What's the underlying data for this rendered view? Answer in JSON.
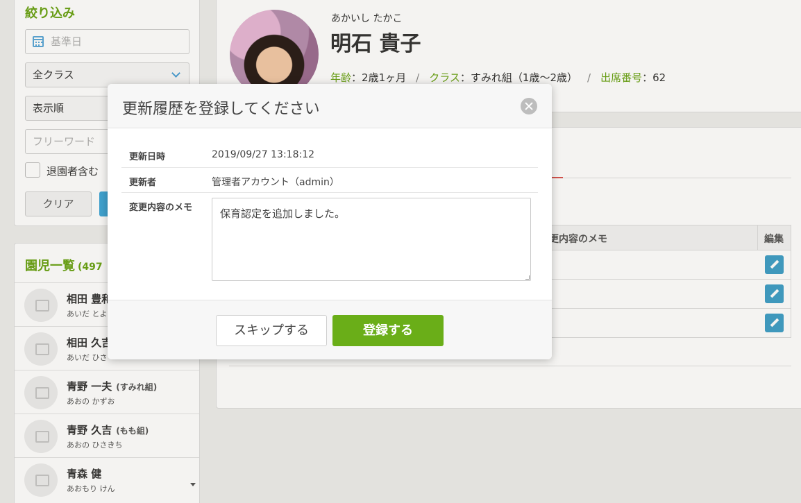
{
  "filter": {
    "title": "絞り込み",
    "date_placeholder": "基準日",
    "class_select": "全クラス",
    "order_select": "表示順",
    "freeword_placeholder": "フリーワード",
    "include_withdrawn": "退園者含む",
    "clear_label": "クリア"
  },
  "child_list": {
    "title": "園児一覧",
    "count": "(497",
    "items": [
      {
        "name": "相田 豊和",
        "class": "",
        "kana": "あいだ とよ"
      },
      {
        "name": "相田 久吉",
        "class": "",
        "kana": "あいだ ひさ"
      },
      {
        "name": "青野 一夫",
        "class": "(すみれ組)",
        "kana": "あおの かずお"
      },
      {
        "name": "青野 久吉",
        "class": "(もも組)",
        "kana": "あおの ひさきち"
      },
      {
        "name": "青森 健",
        "class": "",
        "kana": "あおもり けん"
      }
    ]
  },
  "profile": {
    "kana": "あかいし たかこ",
    "name": "明石 貴子",
    "age_key": "年齢",
    "age_value": "2歳1ヶ月",
    "class_key": "クラス",
    "class_value": "すみれ組（1歳〜2歳）",
    "seat_key": "出席番号",
    "seat_value": "62",
    "colon": "：",
    "separator": "/"
  },
  "history_table": {
    "memo_header": "更内容のメモ",
    "edit_header": "編集"
  },
  "modal": {
    "title": "更新履歴を登録してください",
    "date_label": "更新日時",
    "date_value": "2019/09/27 13:18:12",
    "user_label": "更新者",
    "user_value": "管理者アカウント（admin）",
    "memo_label": "変更内容のメモ",
    "memo_value": "保育認定を追加しました。",
    "skip_label": "スキップする",
    "register_label": "登録する"
  },
  "colors": {
    "accent_green": "#6aa315",
    "button_green": "#6aae18",
    "edit_blue": "#3f9fc7",
    "tab_red": "#d9534f"
  }
}
